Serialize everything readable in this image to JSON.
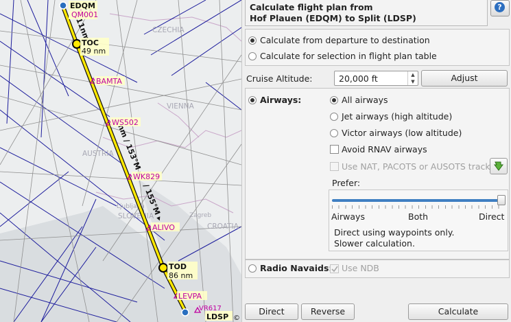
{
  "map": {
    "route": [
      {
        "name": "EDQM"
      },
      {
        "name": "QM001"
      },
      {
        "name": "TOC",
        "dist": "49 nm"
      },
      {
        "name": "BAMTA"
      },
      {
        "name": "WS502"
      },
      {
        "name": "WK829"
      },
      {
        "name": "ALIVO"
      },
      {
        "name": "TOD",
        "dist": "86 nm"
      },
      {
        "name": "LEVPA"
      },
      {
        "name": "VR617"
      },
      {
        "name": "LDSP"
      }
    ],
    "leg_labels": [
      "11nm",
      "nm / 153°M ▸",
      "/ 155°M ▸"
    ],
    "region_labels": [
      "CZECHIA",
      "VIENNA",
      "AUSTRIA",
      "SLOVENIA",
      "Ljubljana",
      "Zagreb",
      "CROATIA"
    ],
    "copyright": "©"
  },
  "header": {
    "line1": "Calculate flight plan from",
    "line2": "Hof Plauen (EDQM) to Split (LDSP)",
    "help_icon": "?"
  },
  "mode": {
    "option1": "Calculate from departure to destination",
    "option2": "Calculate for selection in flight plan table",
    "selected": 1
  },
  "altitude": {
    "label": "Cruise Altitude:",
    "value": "20,000 ft",
    "adjust_label": "Adjust"
  },
  "airways": {
    "label": "Airways:",
    "selected": true,
    "options": [
      "All airways",
      "Jet airways (high altitude)",
      "Victor airways (low altitude)"
    ],
    "option_selected": 0,
    "avoid_rnav": "Avoid RNAV airways",
    "avoid_rnav_checked": false,
    "tracks": "Use NAT, PACOTS or AUSOTS tracks",
    "tracks_enabled": false,
    "prefer_label": "Prefer:",
    "slider_value": 1.0,
    "slider_left": "Airways",
    "slider_mid": "Both",
    "slider_right": "Direct",
    "desc1": "Direct using waypoints only.",
    "desc2": "Slower calculation."
  },
  "radio_navaids": {
    "label": "Radio Navaids:",
    "selected": false,
    "use_ndb": "Use NDB",
    "use_ndb_checked": true
  },
  "buttons": {
    "direct": "Direct",
    "reverse": "Reverse",
    "calculate": "Calculate"
  },
  "colors": {
    "route": "#ffe800",
    "waypoint": "#c000a0",
    "airway_blue": "#1c1c9c",
    "slider": "#3f7fc2"
  }
}
